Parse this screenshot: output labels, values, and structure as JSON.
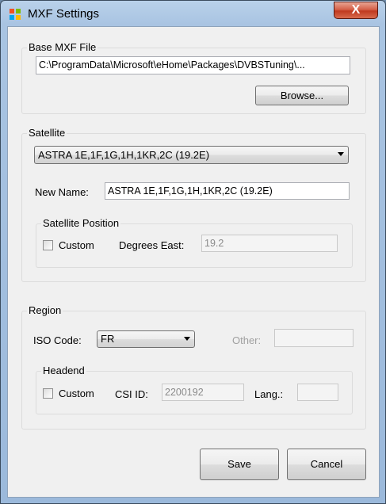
{
  "window": {
    "title": "MXF Settings",
    "close_glyph": "X",
    "icon": "app-windows-icon"
  },
  "base_mxf": {
    "group_label": "Base MXF File",
    "path_value": "C:\\ProgramData\\Microsoft\\eHome\\Packages\\DVBSTuning\\...",
    "browse_label": "Browse..."
  },
  "satellite": {
    "group_label": "Satellite",
    "selected": "ASTRA 1E,1F,1G,1H,1KR,2C (19.2E)",
    "new_name_label": "New Name:",
    "new_name_value": "ASTRA 1E,1F,1G,1H,1KR,2C (19.2E)",
    "position": {
      "group_label": "Satellite Position",
      "custom_label": "Custom",
      "custom_checked": false,
      "degrees_label": "Degrees East:",
      "degrees_value": "19.2"
    }
  },
  "region": {
    "group_label": "Region",
    "iso_label": "ISO Code:",
    "iso_value": "FR",
    "other_label": "Other:",
    "other_value": "",
    "headend": {
      "group_label": "Headend",
      "custom_label": "Custom",
      "custom_checked": false,
      "csi_label": "CSI ID:",
      "csi_value": "2200192",
      "lang_label": "Lang.:",
      "lang_value": ""
    }
  },
  "footer": {
    "save_label": "Save",
    "cancel_label": "Cancel"
  },
  "colors": {
    "close_button": "#c0391f",
    "title_bar": "#b9d1ea",
    "client_bg": "#f0f0f0"
  }
}
